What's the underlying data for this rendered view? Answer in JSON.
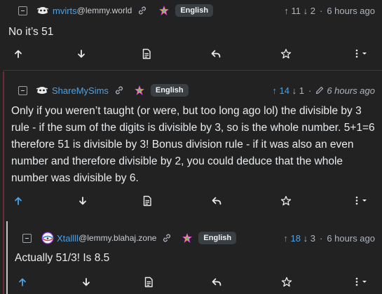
{
  "comments": [
    {
      "user": "mvirts",
      "instance": "@lemmy.world",
      "language": "English",
      "upvotes": "11",
      "downvotes": "2",
      "time": "6 hours ago",
      "body": "No it’s 51"
    },
    {
      "user": "ShareMySims",
      "instance": "",
      "language": "English",
      "upvotes": "14",
      "downvotes": "1",
      "time": "6 hours ago",
      "body": "Only if you weren’t taught (or were, but too long ago lol) the divisible by 3 rule - if the sum of the digits is divisible by 3, so is the whole number. 5+1=6 therefore 51 is divisible by 3! Bonus division rule - if it was also an even number and therefore divisible by 2, you could deduce that the whole number was divisible by 6."
    },
    {
      "user": "Xtallll",
      "instance": "@lemmy.blahaj.zone",
      "language": "English",
      "upvotes": "18",
      "downvotes": "3",
      "time": "6 hours ago",
      "body": "Actually 51/3! Is 8.5"
    }
  ],
  "arrows": {
    "up": "↑",
    "down": "↓",
    "dot": "·"
  },
  "icons": [
    "collapse-icon",
    "avatar-icon",
    "link-icon",
    "rainbow-flag-icon",
    "upvote-icon",
    "downvote-icon",
    "source-icon",
    "reply-icon",
    "star-icon",
    "more-icon",
    "pencil-icon"
  ],
  "colors": {
    "accent": "#4aa3e8",
    "background": "#222222",
    "thread_line_2": "#6b2b35",
    "thread_line_3": "#c5c5c5"
  }
}
